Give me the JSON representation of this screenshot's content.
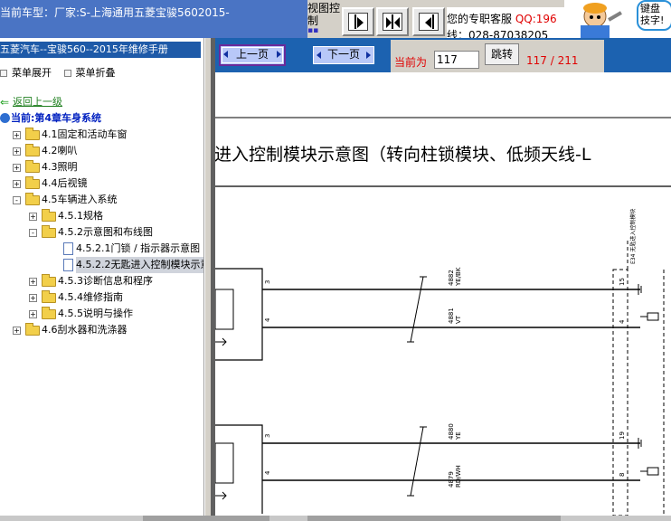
{
  "header": {
    "vehicle_title": "当前车型：厂家:S-上海通用五菱宝骏5602015-",
    "view_control": "视图控制",
    "view_hint": "▪▪",
    "service_label": "您的专职客服 ",
    "service_qq": "QQ:196",
    "service_phone": "线：028-87038205",
    "ad_text": "键盘技字!",
    "nav_icons": [
      "page-forward-icon",
      "fit-width-icon",
      "page-back-icon"
    ]
  },
  "sidebar": {
    "manual_title": "五菱汽车--宝骏560--2015年维修手册",
    "expand_label": "菜单展开",
    "collapse_label": "菜单折叠",
    "back_label": "返回上一级",
    "current_label": "当前:第4章车身系统",
    "items": [
      {
        "label": "4.1固定和活动车窗",
        "level": 0,
        "type": "folder",
        "expander": "+"
      },
      {
        "label": "4.2喇叭",
        "level": 0,
        "type": "folder",
        "expander": "+"
      },
      {
        "label": "4.3照明",
        "level": 0,
        "type": "folder",
        "expander": "+"
      },
      {
        "label": "4.4后视镜",
        "level": 0,
        "type": "folder",
        "expander": "+"
      },
      {
        "label": "4.5车辆进入系统",
        "level": 0,
        "type": "folder",
        "expander": "-"
      },
      {
        "label": "4.5.1规格",
        "level": 1,
        "type": "folder",
        "expander": "+"
      },
      {
        "label": "4.5.2示意图和布线图",
        "level": 1,
        "type": "folder",
        "expander": "-"
      },
      {
        "label": "4.5.2.1门锁 / 指示器示意图",
        "level": 2,
        "type": "doc",
        "expander": ""
      },
      {
        "label": "4.5.2.2无匙进入控制模块示意",
        "level": 2,
        "type": "doc",
        "expander": "",
        "selected": true
      },
      {
        "label": "4.5.3诊断信息和程序",
        "level": 1,
        "type": "folder",
        "expander": "+"
      },
      {
        "label": "4.5.4维修指南",
        "level": 1,
        "type": "folder",
        "expander": "+"
      },
      {
        "label": "4.5.5说明与操作",
        "level": 1,
        "type": "folder",
        "expander": "+"
      },
      {
        "label": "4.6刮水器和洗涤器",
        "level": 0,
        "type": "folder",
        "expander": "+"
      }
    ]
  },
  "toolbar": {
    "prev_label": "上一页",
    "next_label": "下一页",
    "page_label": "当前为",
    "page_value": "117",
    "jump_label": "跳转",
    "page_count": "117 / 211"
  },
  "document": {
    "title": "进入控制模块示意图（转向柱锁模块、低频天线-L",
    "connector_label": "E34 无匙进入控制模块",
    "wires": [
      {
        "circuit": "4882",
        "color": "YE/BK",
        "pin_left": "3",
        "pin_right": "15"
      },
      {
        "circuit": "4881",
        "color": "VT",
        "pin_left": "4",
        "pin_right": "4"
      },
      {
        "circuit": "4880",
        "color": "YE",
        "pin_left": "3",
        "pin_right": "19"
      },
      {
        "circuit": "4879",
        "color": "RD/WH",
        "pin_left": "4",
        "pin_right": "8"
      }
    ]
  }
}
